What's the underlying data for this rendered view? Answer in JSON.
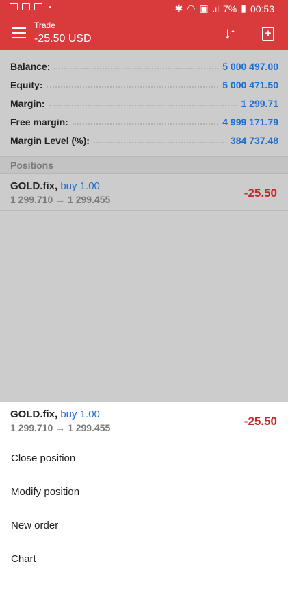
{
  "status_bar": {
    "battery": "7%",
    "time": "00:53",
    "signal_text": ".ıl"
  },
  "appbar": {
    "title": "Trade",
    "subtitle": "-25.50 USD",
    "sort_glyph": "↓↑",
    "add_glyph": "+"
  },
  "summary": [
    {
      "label": "Balance:",
      "value": "5 000 497.00"
    },
    {
      "label": "Equity:",
      "value": "5 000 471.50"
    },
    {
      "label": "Margin:",
      "value": "1 299.71"
    },
    {
      "label": "Free margin:",
      "value": "4 999 171.79"
    },
    {
      "label": "Margin Level (%):",
      "value": "384 737.48"
    }
  ],
  "positions_header": "Positions",
  "position": {
    "symbol": "GOLD.fix,",
    "side": "buy 1.00",
    "prices": "1 299.710 → 1 299.455",
    "profit": "-25.50"
  },
  "sheet": {
    "symbol": "GOLD.fix,",
    "side": "buy 1.00",
    "prices": "1 299.710 → 1 299.455",
    "profit": "-25.50",
    "menu": [
      "Close position",
      "Modify position",
      "New order",
      "Chart"
    ]
  },
  "colors": {
    "header_red": "#d93a3c",
    "value_blue": "#1d6fd0",
    "loss_red": "#c62828",
    "dim_background": "#cccccc"
  }
}
